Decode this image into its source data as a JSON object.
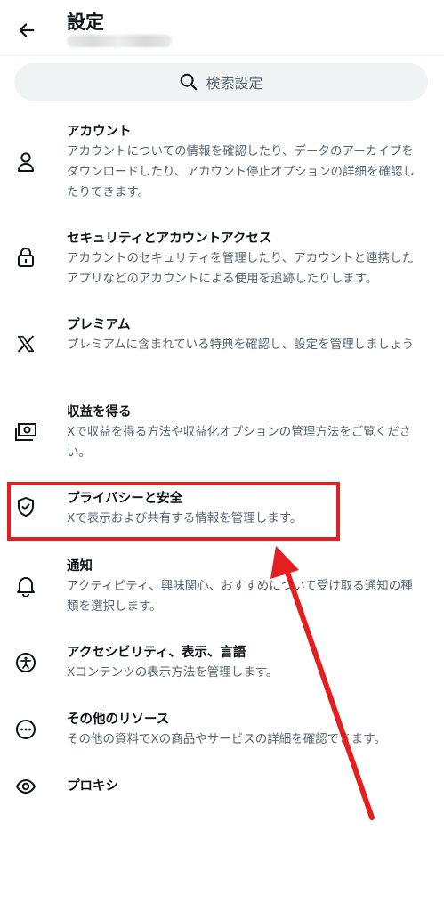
{
  "header": {
    "back_label": "←",
    "title": "設定"
  },
  "search": {
    "placeholder": "検索設定"
  },
  "items": [
    {
      "title": "アカウント",
      "desc": "アカウントについての情報を確認したり、データのアーカイブをダウンロードしたり、アカウント停止オプションの詳細を確認したりできます。",
      "icon": "person-icon"
    },
    {
      "title": "セキュリティとアカウントアクセス",
      "desc": "アカウントのセキュリティを管理したり、アカウントと連携したアプリなどのアカウントによる使用を追跡したりします。",
      "icon": "lock-icon"
    },
    {
      "title": "プレミアム",
      "desc": "プレミアムに含まれている特典を確認し、設定を管理しましょう",
      "icon": "x-logo-icon"
    },
    {
      "title": "収益を得る",
      "desc": "Xで収益を得る方法や収益化オプションの管理方法をご覧ください。",
      "icon": "money-icon"
    },
    {
      "title": "プライバシーと安全",
      "desc": "Xで表示および共有する情報を管理します。",
      "icon": "shield-icon"
    },
    {
      "title": "通知",
      "desc": "アクティビティ、興味関心、おすすめについて受け取る通知の種類を選択します。",
      "icon": "bell-icon"
    },
    {
      "title": "アクセシビリティ、表示、言語",
      "desc": "Xコンテンツの表示方法を管理します。",
      "icon": "accessibility-icon"
    },
    {
      "title": "その他のリソース",
      "desc": "その他の資料でXの商品やサービスの詳細を確認できます。",
      "icon": "more-icon"
    },
    {
      "title": "プロキシ",
      "desc": "",
      "icon": "eye-icon"
    }
  ],
  "colors": {
    "highlight": "#e41f1f",
    "text_primary": "#0f1419",
    "text_secondary": "#536471",
    "search_bg": "#eff3f4"
  }
}
